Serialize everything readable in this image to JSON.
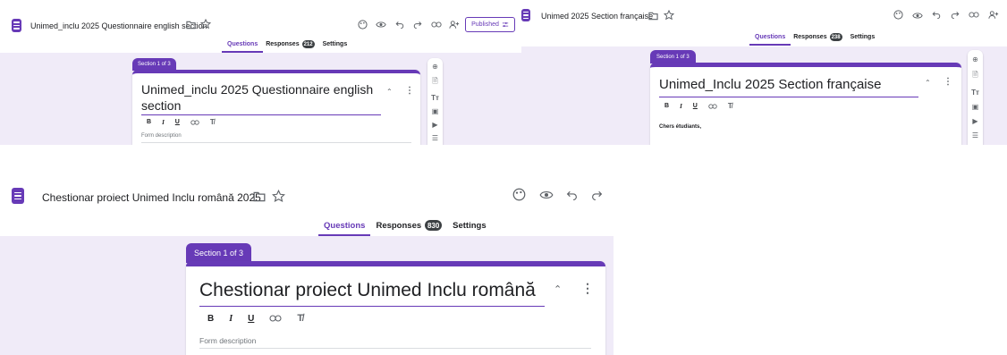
{
  "panel_en": {
    "title": "Unimed_inclu 2025 Questionnaire english section",
    "published_label": "Published",
    "tabs": {
      "questions": "Questions",
      "responses": "Responses",
      "responses_count": "212",
      "settings": "Settings"
    },
    "section_label": "Section 1 of 3",
    "form_title": "Unimed_inclu 2025 Questionnaire english section",
    "format": {
      "bold": "B",
      "italic": "I",
      "underline": "U"
    },
    "form_description_placeholder": "Form description"
  },
  "panel_fr": {
    "title": "Unimed 2025 Section française",
    "tabs": {
      "questions": "Questions",
      "responses": "Responses",
      "responses_count": "238",
      "settings": "Settings"
    },
    "section_label": "Section 1 of 3",
    "form_title": "Unimed_Inclu 2025 Section française",
    "format": {
      "bold": "B",
      "italic": "I",
      "underline": "U"
    },
    "description_text": "Chers étudiants,"
  },
  "panel_ro": {
    "title": "Chestionar proiect Unimed Inclu română 2025",
    "tabs": {
      "questions": "Questions",
      "responses": "Responses",
      "responses_count": "830",
      "settings": "Settings"
    },
    "section_label": "Section 1 of 3",
    "form_title": "Chestionar proiect Unimed Inclu română",
    "format": {
      "bold": "B",
      "italic": "I",
      "underline": "U"
    },
    "form_description_placeholder": "Form description"
  },
  "colors": {
    "accent": "#673ab7",
    "background": "#f0ebf8",
    "badge": "#3c4043"
  }
}
